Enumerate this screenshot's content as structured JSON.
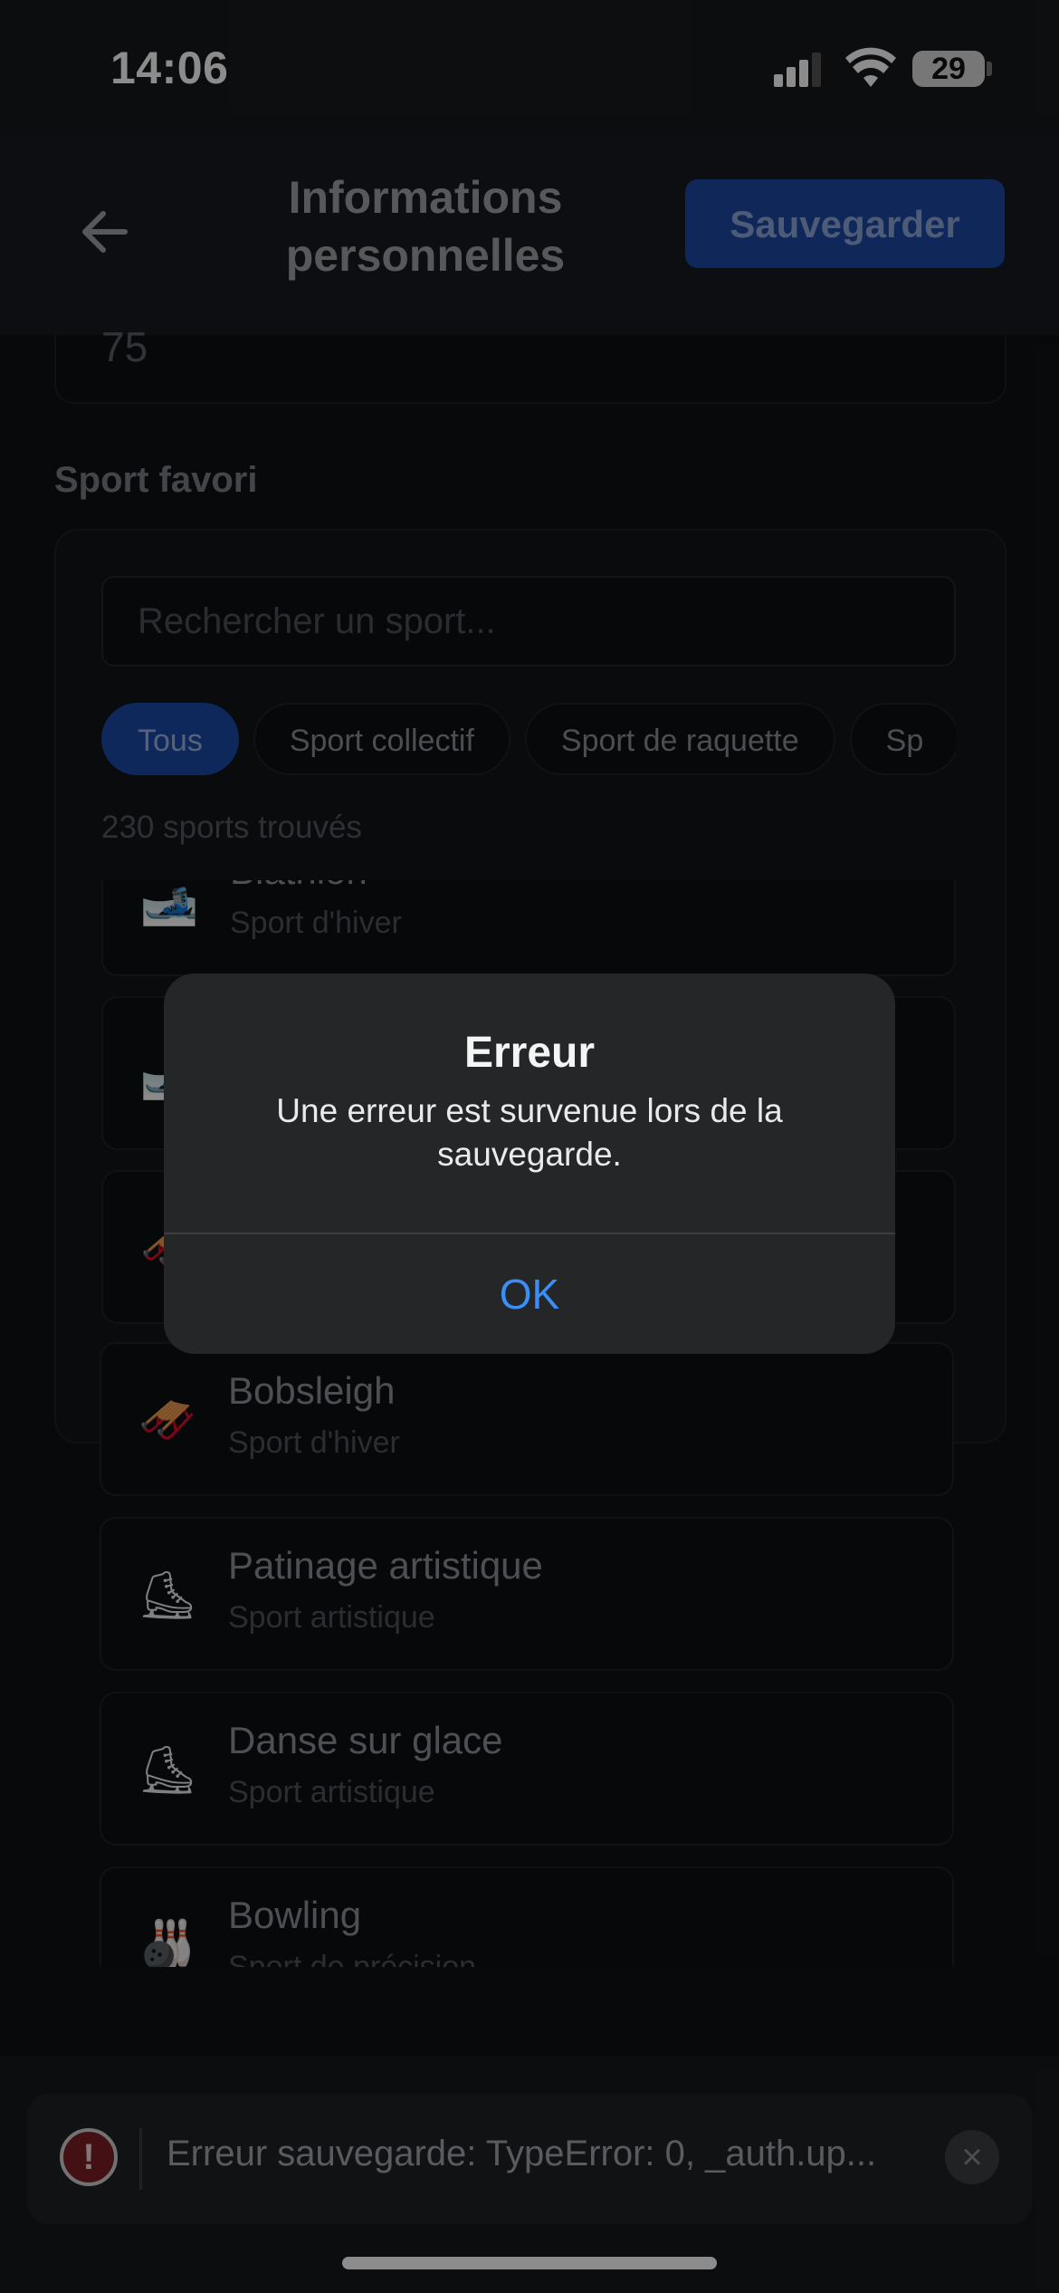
{
  "status_bar": {
    "time": "14:06",
    "battery": "29"
  },
  "header": {
    "title_line1": "Informations",
    "title_line2": "personnelles",
    "save_label": "Sauvegarder"
  },
  "weight": {
    "value": "75"
  },
  "sport_section": {
    "label": "Sport favori",
    "search_placeholder": "Rechercher un sport...",
    "chips": [
      "Tous",
      "Sport collectif",
      "Sport de raquette",
      "Sp"
    ],
    "count_text": "230 sports trouvés",
    "items": [
      {
        "name": "Biathlon",
        "category": "Sport d'hiver",
        "icon": "🎿"
      },
      {
        "name": "",
        "category": "",
        "icon": "🎿"
      },
      {
        "name": "",
        "category": "",
        "icon": "🛷"
      },
      {
        "name": "Bobsleigh",
        "category": "Sport d'hiver",
        "icon": "🛷"
      },
      {
        "name": "Patinage artistique",
        "category": "Sport artistique",
        "icon": "⛸"
      },
      {
        "name": "Danse sur glace",
        "category": "Sport artistique",
        "icon": "⛸"
      },
      {
        "name": "Bowling",
        "category": "Sport de précision",
        "icon": "🎳"
      }
    ]
  },
  "toast": {
    "icon": "!",
    "text": "Erreur sauvegarde: TypeError: 0, _auth.up..."
  },
  "alert": {
    "title": "Erreur",
    "message": "Une erreur est survenue lors de la sauvegarde.",
    "ok_label": "OK"
  }
}
